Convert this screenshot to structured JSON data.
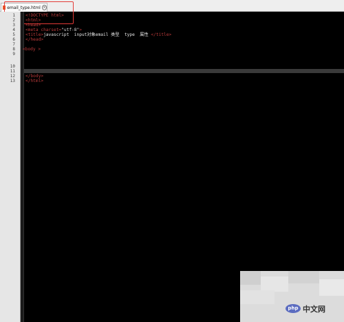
{
  "tab": {
    "filename": "email_type.html",
    "close_glyph": "×"
  },
  "line_numbers": [
    "1",
    "2",
    "3",
    "4",
    "5",
    "6",
    "7",
    "8",
    "9",
    "10",
    "11",
    "12",
    "13"
  ],
  "code": {
    "l1": "<!DOCTYPE html>",
    "l2": "<html>",
    "l3": "<head>",
    "l4_open": "<meta charset=",
    "l4_value": "\"utf-8\"",
    "l4_close": ">",
    "l5_open": "<title>",
    "l5_text": "javascript  input对象email 类型  type  属性 ",
    "l5_close": "</title>",
    "l6": "</head>",
    "l8": "<body >",
    "l12": "</body>",
    "l13": "</html>"
  },
  "watermark": {
    "logo": "php",
    "text": "中文网"
  },
  "colors": {
    "tag": "#b83a3a",
    "background": "#000000",
    "highlight": "#e33a36"
  }
}
